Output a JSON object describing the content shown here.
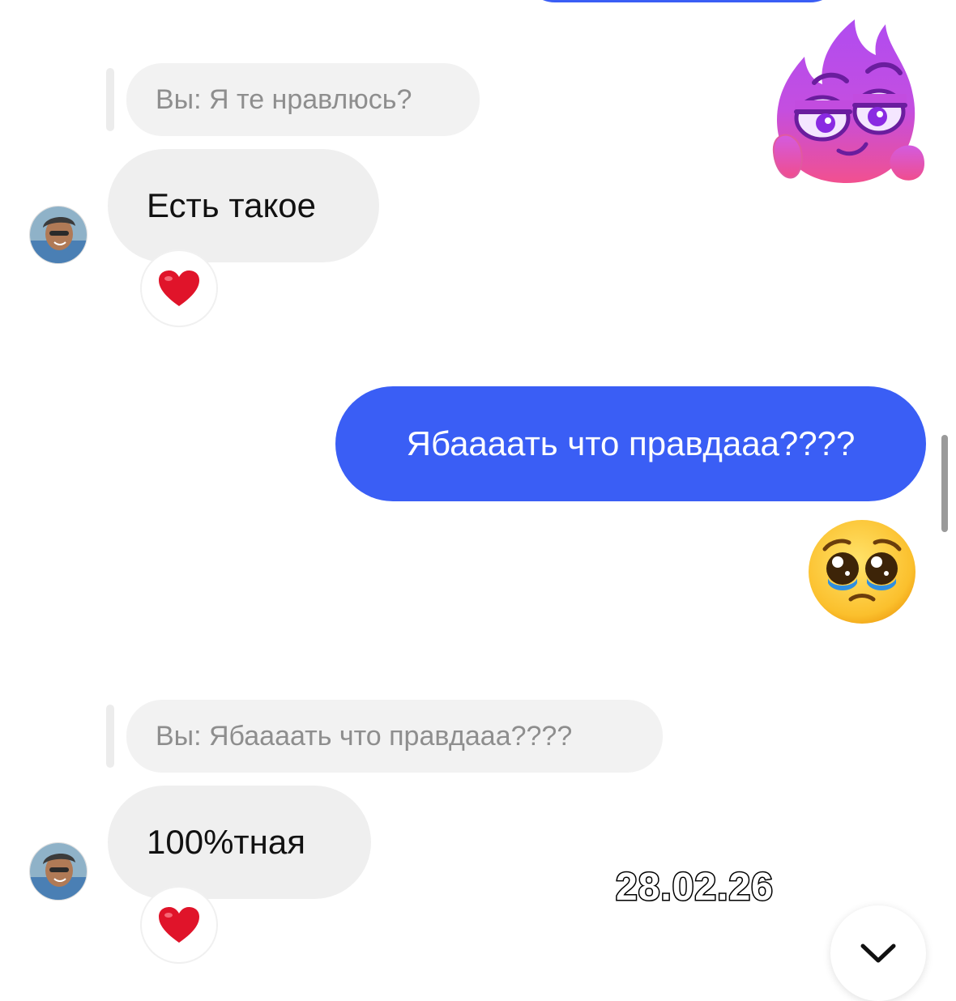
{
  "chat": {
    "messages": {
      "reply1": {
        "quote": "Вы: Я те нравлюсь?",
        "text": "Есть такое",
        "reaction": "heart-emoji"
      },
      "outgoing1": {
        "text": "Ябаааать что правдааа????"
      },
      "reply2": {
        "quote": "Вы: Ябаааать что правдааа????",
        "text": "100%тная",
        "reaction": "heart-emoji"
      }
    },
    "stickers": [
      "purple-fire-character-sticker",
      "pleading-face-emoji"
    ]
  },
  "overlay": {
    "date": "28.02.26"
  },
  "colors": {
    "outgoing": "#3a5ef5",
    "incoming": "#efefef",
    "quote_text": "#8e8e8e"
  }
}
